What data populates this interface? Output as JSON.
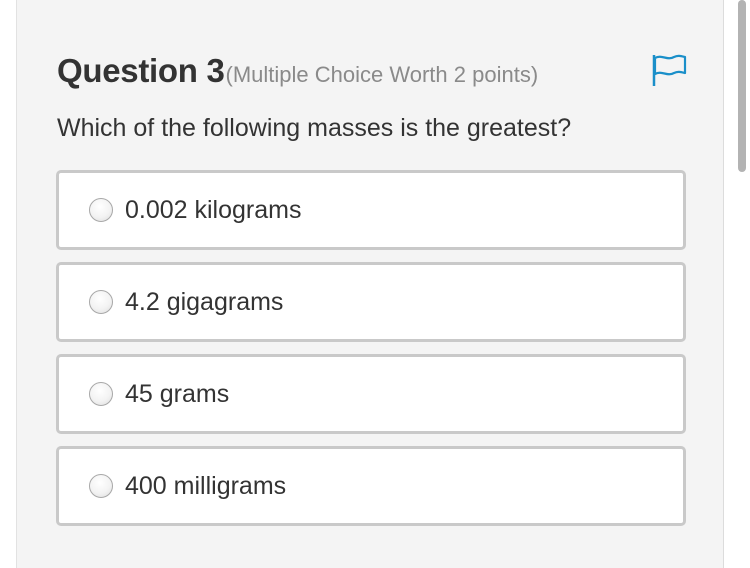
{
  "question": {
    "title": "Question 3",
    "meta": "(Multiple Choice Worth 2 points)",
    "prompt": "Which of the following masses is the greatest?",
    "flag_icon": "flag-icon"
  },
  "options": [
    {
      "label": "0.002 kilograms",
      "selected": false
    },
    {
      "label": "4.2 gigagrams",
      "selected": false
    },
    {
      "label": "45 grams",
      "selected": false
    },
    {
      "label": "400 milligrams",
      "selected": false
    }
  ],
  "colors": {
    "accent": "#1a8fc9",
    "panel_bg": "#f4f4f4",
    "border": "#c9c9c9",
    "text": "#333333",
    "meta_text": "#8a8a8a"
  }
}
